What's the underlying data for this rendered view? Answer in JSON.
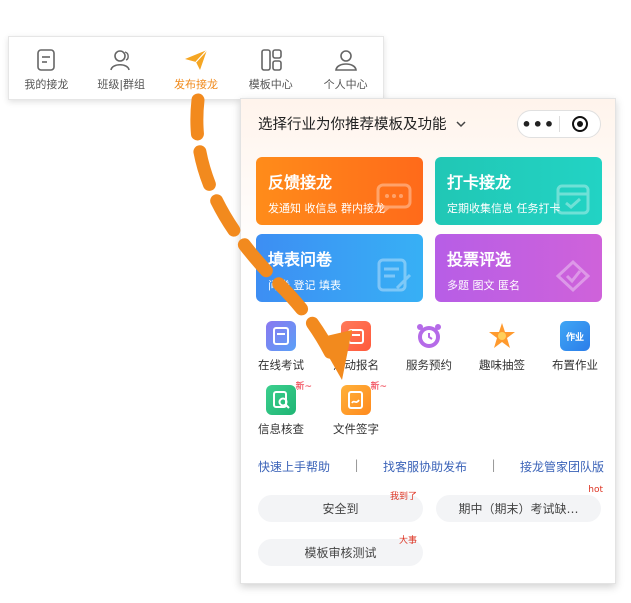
{
  "tabbar": {
    "tabs": [
      {
        "label": "我的接龙",
        "icon": "note-icon",
        "active": false
      },
      {
        "label": "班级|群组",
        "icon": "group-icon",
        "active": false
      },
      {
        "label": "发布接龙",
        "icon": "send-plane-icon",
        "active": true
      },
      {
        "label": "模板中心",
        "icon": "template-grid-icon",
        "active": false
      },
      {
        "label": "个人中心",
        "icon": "user-icon",
        "active": false
      }
    ],
    "active_color": "#f08a1c"
  },
  "panel": {
    "header": "选择行业为你推荐模板及功能",
    "capsule": {
      "more_icon": "more-dots-icon",
      "close_icon": "record-icon"
    },
    "cards": [
      {
        "title": "反馈接龙",
        "sub": "发通知 收信息 群内接龙",
        "icon": "chat-bubble-icon"
      },
      {
        "title": "打卡接龙",
        "sub": "定期收集信息 任务打卡",
        "icon": "calendar-icon"
      },
      {
        "title": "填表问卷",
        "sub": "问卷 登记 填表",
        "icon": "edit-form-icon"
      },
      {
        "title": "投票评选",
        "sub": "多题 图文 匿名",
        "icon": "vote-icon"
      }
    ],
    "functions": [
      {
        "label": "在线考试",
        "icon": "exam-icon",
        "new": ""
      },
      {
        "label": "活动报名",
        "icon": "signup-icon",
        "new": ""
      },
      {
        "label": "服务预约",
        "icon": "alarm-clock-icon",
        "new": ""
      },
      {
        "label": "趣味抽签",
        "icon": "star-burst-icon",
        "new": ""
      },
      {
        "label": "布置作业",
        "icon": "homework-icon",
        "new": ""
      },
      {
        "label": "信息核查",
        "icon": "search-clipboard-icon",
        "new": "新~"
      },
      {
        "label": "文件签字",
        "icon": "sign-file-icon",
        "new": "新~"
      }
    ],
    "homework_badge": "作业",
    "links": [
      "快速上手帮助",
      "找客服协助发布",
      "接龙管家团队版"
    ],
    "pills": [
      {
        "label": "安全到",
        "tag": "我到了"
      },
      {
        "label": "期中（期末）考试缺…",
        "tag": "hot"
      },
      {
        "label": "模板审核测试",
        "tag": "大事"
      }
    ]
  }
}
